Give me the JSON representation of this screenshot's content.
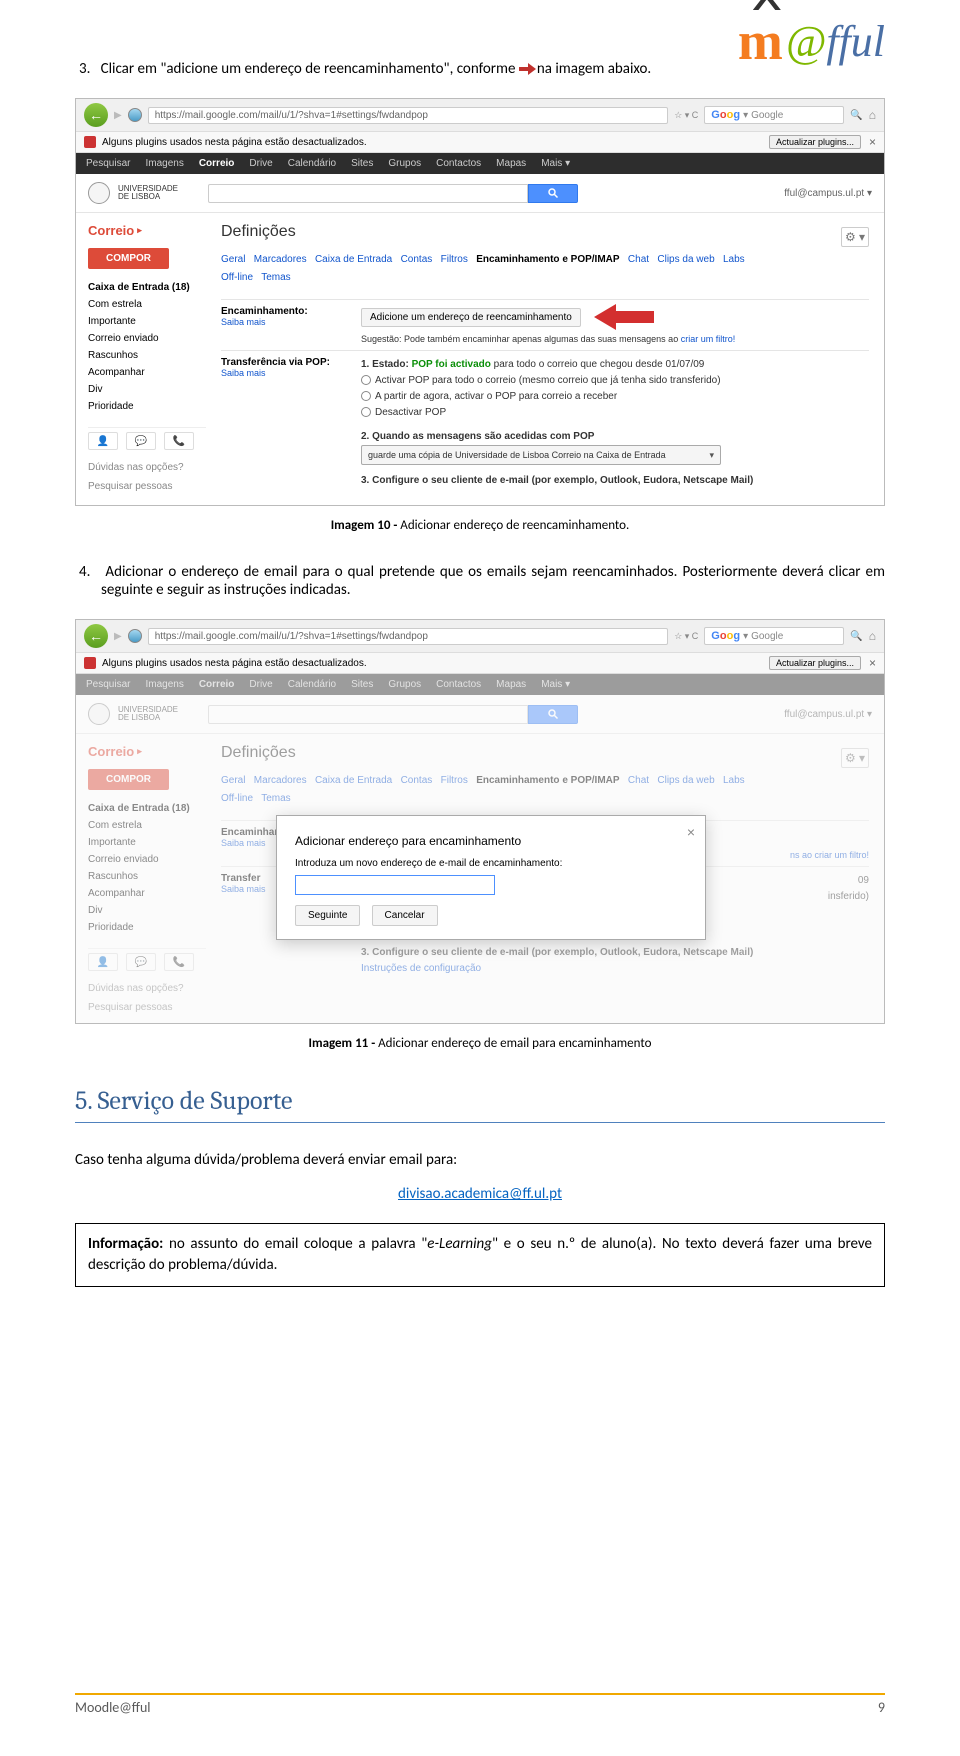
{
  "logo": {
    "m": "m",
    "at": "@",
    "fful": "fful"
  },
  "step3": {
    "num": "3.",
    "text_before": "Clicar em \"adicione um endereço de reencaminhamento\", conforme ",
    "text_after": "na imagem abaixo."
  },
  "browser": {
    "url": "https://mail.google.com/mail/u/1/?shva=1#settings/fwdandpop",
    "search_placeholder": "Google",
    "plugin_warning": "Alguns plugins usados nesta página estão desactualizados.",
    "plugin_btn": "Actualizar plugins...",
    "star_chevron": "☆ ▾ C"
  },
  "google_bar": [
    "Pesquisar",
    "Imagens",
    "Correio",
    "Drive",
    "Calendário",
    "Sites",
    "Grupos",
    "Contactos",
    "Mapas",
    "Mais ▾"
  ],
  "gmail": {
    "uni_line1": "UNIVERSIDADE",
    "uni_line2": "DE LISBOA",
    "user_email": "fful@campus.ul.pt ▾",
    "correio": "Correio",
    "compor": "COMPOR",
    "sidebar": [
      "Caixa de Entrada (18)",
      "Com estrela",
      "Importante",
      "Correio enviado",
      "Rascunhos",
      "Acompanhar",
      "Div",
      "Prioridade"
    ],
    "duvidas": "Dúvidas nas opções?",
    "pesquisar_pessoas": "Pesquisar pessoas",
    "definicoes": "Definições",
    "tabs": {
      "geral": "Geral",
      "marcadores": "Marcadores",
      "caixa": "Caixa de Entrada",
      "contas": "Contas",
      "filtros": "Filtros",
      "enc": "Encaminhamento e POP/IMAP",
      "chat": "Chat",
      "clips": "Clips da web",
      "labs": "Labs",
      "offline": "Off-line",
      "temas": "Temas"
    },
    "encaminhamento_label": "Encaminhamento:",
    "saiba_mais": "Saiba mais",
    "add_fwd_btn": "Adicione um endereço de reencaminhamento",
    "suggestion": "Sugestão: Pode também encaminhar apenas algumas das suas mensagens ao ",
    "suggestion_link": "criar um filtro!",
    "pop_label": "Transferência via POP:",
    "pop_estado_label": "1. Estado: ",
    "pop_estado_value": "POP foi activado",
    "pop_estado_rest": " para todo o correio que chegou desde 01/07/09",
    "pop_opt1": "Activar POP para todo o correio (mesmo correio que já tenha sido transferido)",
    "pop_opt2": "A partir de agora, activar o POP para correio a receber",
    "pop_opt3": "Desactivar POP",
    "pop_q2": "2. Quando as mensagens são acedidas com POP",
    "pop_select": "guarde uma cópia de Universidade de Lisboa Correio na Caixa de Entrada",
    "pop_q3": "3. Configure o seu cliente de e-mail (por exemplo, Outlook, Eudora, Netscape Mail)",
    "pop_q3b": "Instruções de configuração"
  },
  "caption1": {
    "label": "Imagem 10 -",
    "text": " Adicionar endereço de reencaminhamento."
  },
  "step4": {
    "num": "4.",
    "text": "Adicionar o endereço de email para o qual pretende que os emails sejam reencaminhados. Posteriormente deverá clicar em seguinte e seguir as instruções indicadas."
  },
  "modal": {
    "title": "Adicionar endereço para encaminhamento",
    "sub": "Introduza um novo endereço de e-mail de encaminhamento:",
    "seguinte": "Seguinte",
    "cancelar": "Cancelar",
    "faded_suffix1": "ns ao criar um filtro!",
    "faded_suffix2": "09",
    "faded_suffix3": "insferido)",
    "faded_suffix4": "letscape Mail)"
  },
  "caption2": {
    "label": "Imagem 11 -",
    "text": " Adicionar endereço de email para encaminhamento"
  },
  "section5": {
    "title": "5. Serviço de Suporte",
    "intro": "Caso tenha alguma dúvida/problema deverá enviar email para:",
    "email": "divisao.academica@ff.ul.pt",
    "infobox": "Informação: no assunto do email coloque a palavra \"e-Learning\" e o seu n.º de aluno(a). No texto deverá fazer uma breve descrição do problema/dúvida.",
    "infobox_bold": "Informação:"
  },
  "footer": {
    "left": "Moodle@fful",
    "right": "9"
  }
}
